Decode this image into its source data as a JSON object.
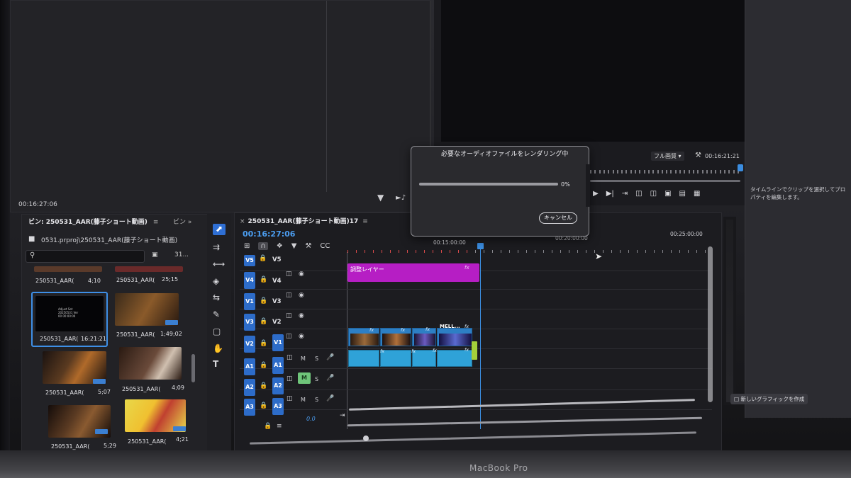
{
  "source_monitor": {
    "timecode": "00:16:27:06"
  },
  "program_monitor": {
    "quality": "フル画質",
    "timecode": "00:16:21:21"
  },
  "project": {
    "tab_label": "ビン: 250531_AAR(藤子ショート動画)",
    "tab2_label": "ビン",
    "path": "0531.prproj\\250531_AAR(藤子ショート動画)",
    "search_placeholder": "",
    "items": [
      {
        "name": "250531_AAR(",
        "duration": "4;10"
      },
      {
        "name": "250531_AAR(",
        "duration": "25;15"
      },
      {
        "name": "250531_AAR(",
        "duration": "16:21:21",
        "thumb_text": "Adjust Set\n20250531 Ver\n00 00:00:00"
      },
      {
        "name": "250531_AAR(",
        "duration": "1;49;02"
      },
      {
        "name": "250531_AAR(",
        "duration": "5;07"
      },
      {
        "name": "250531_AAR(",
        "duration": "4;09"
      },
      {
        "name": "250531_AAR(",
        "duration": "5;29"
      },
      {
        "name": "250531_AAR(",
        "duration": "4;21"
      }
    ]
  },
  "timeline": {
    "sequence_name": "250531_AAR(藤子ショート動画)17",
    "timecode": "00:16:27:06",
    "ruler": [
      "00:15:00:00",
      "00:20:00:00",
      "00:25:00:00"
    ],
    "video_tracks": [
      {
        "src": "V5",
        "tgt": "V5"
      },
      {
        "src": "V4",
        "tgt": "V4"
      },
      {
        "src": "V1",
        "tgt": "V3"
      },
      {
        "src": "V3",
        "tgt": "V2"
      },
      {
        "src": "V2",
        "tgt": "V1"
      }
    ],
    "audio_tracks": [
      {
        "src": "A1",
        "tgt": "A1"
      },
      {
        "src": "A2",
        "tgt": "A2"
      },
      {
        "src": "A3",
        "tgt": "A3"
      }
    ],
    "adjustment_clip": "調整レイヤー",
    "clip_label": "MELL...",
    "master_volume": "0.0",
    "fx": "fx"
  },
  "dialog": {
    "title": "必要なオーディオファイルをレンダリング中",
    "progress_pct": 0,
    "progress_label": "0%",
    "cancel_label": "キャンセル"
  },
  "properties": {
    "hint": "タイムラインでクリップを選択してプロパティを編集します。",
    "new_graphic_label": "新しいグラフィックを作成"
  },
  "device": {
    "brand": "MacBook Pro"
  },
  "colors": {
    "accent": "#3b8de0",
    "adjustment": "#b61ec4",
    "audio": "#2fa2d8",
    "video": "#2d7fc4"
  }
}
